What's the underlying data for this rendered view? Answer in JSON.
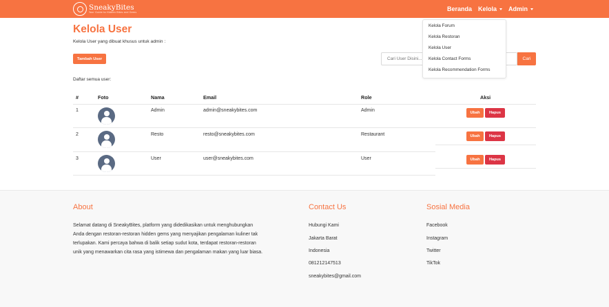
{
  "brand": {
    "name": "SneakyBites",
    "tagline": "Your Guide to Hidden Bites and Gems"
  },
  "nav": {
    "home": "Beranda",
    "manage": "Kelola",
    "admin": "Admin"
  },
  "dropdown": [
    "Kelola Forum",
    "Kelola Restoran",
    "Kelola User",
    "Kelola Contact Forms",
    "Kelola Recommendation Forms"
  ],
  "page": {
    "title": "Kelola User",
    "description": "Kelola User yang dibuat khusus untuk admin :",
    "add_button": "Tambah User",
    "list_label": "Daftar semua user:"
  },
  "search": {
    "placeholder": "Cari User Disini...",
    "button": "Cari"
  },
  "table": {
    "headers": [
      "#",
      "Foto",
      "Nama",
      "Email",
      "Role",
      "Aksi"
    ],
    "rows": [
      {
        "no": "1",
        "name": "Admin",
        "email": "admin@sneakybites.com",
        "role": "Admin"
      },
      {
        "no": "2",
        "name": "Resto",
        "email": "resto@sneakybites.com",
        "role": "Restaurant"
      },
      {
        "no": "3",
        "name": "User",
        "email": "user@sneakybites.com",
        "role": "User"
      }
    ],
    "edit_label": "Ubah",
    "delete_label": "Hapus"
  },
  "footer": {
    "about_title": "About",
    "about_lines": [
      "Selamat datang di SneakyBites, platform yang didedikasikan untuk menghubungkan",
      "Anda dengan restoran-restoran hidden gems yang menyajikan pengalaman kuliner tak",
      "terlupakan. Kami percaya bahwa di balik setiap sudut kota, terdapat restoran-restoran",
      "unik yang menawarkan cita rasa yang istimewa dan pengalaman makan yang luar biasa."
    ],
    "contact_title": "Contact Us",
    "contact": [
      "Hubungi Kami",
      "Jakarta Barat",
      "Indonesia",
      "081212147513",
      "sneakybites@gmail.com"
    ],
    "social_title": "Sosial Media",
    "social": [
      "Facebook",
      "Instagram",
      "Twitter",
      "TikTok"
    ]
  },
  "colors": {
    "accent": "#f77341",
    "danger": "#dc3545",
    "avatar": "#5a6a83"
  }
}
